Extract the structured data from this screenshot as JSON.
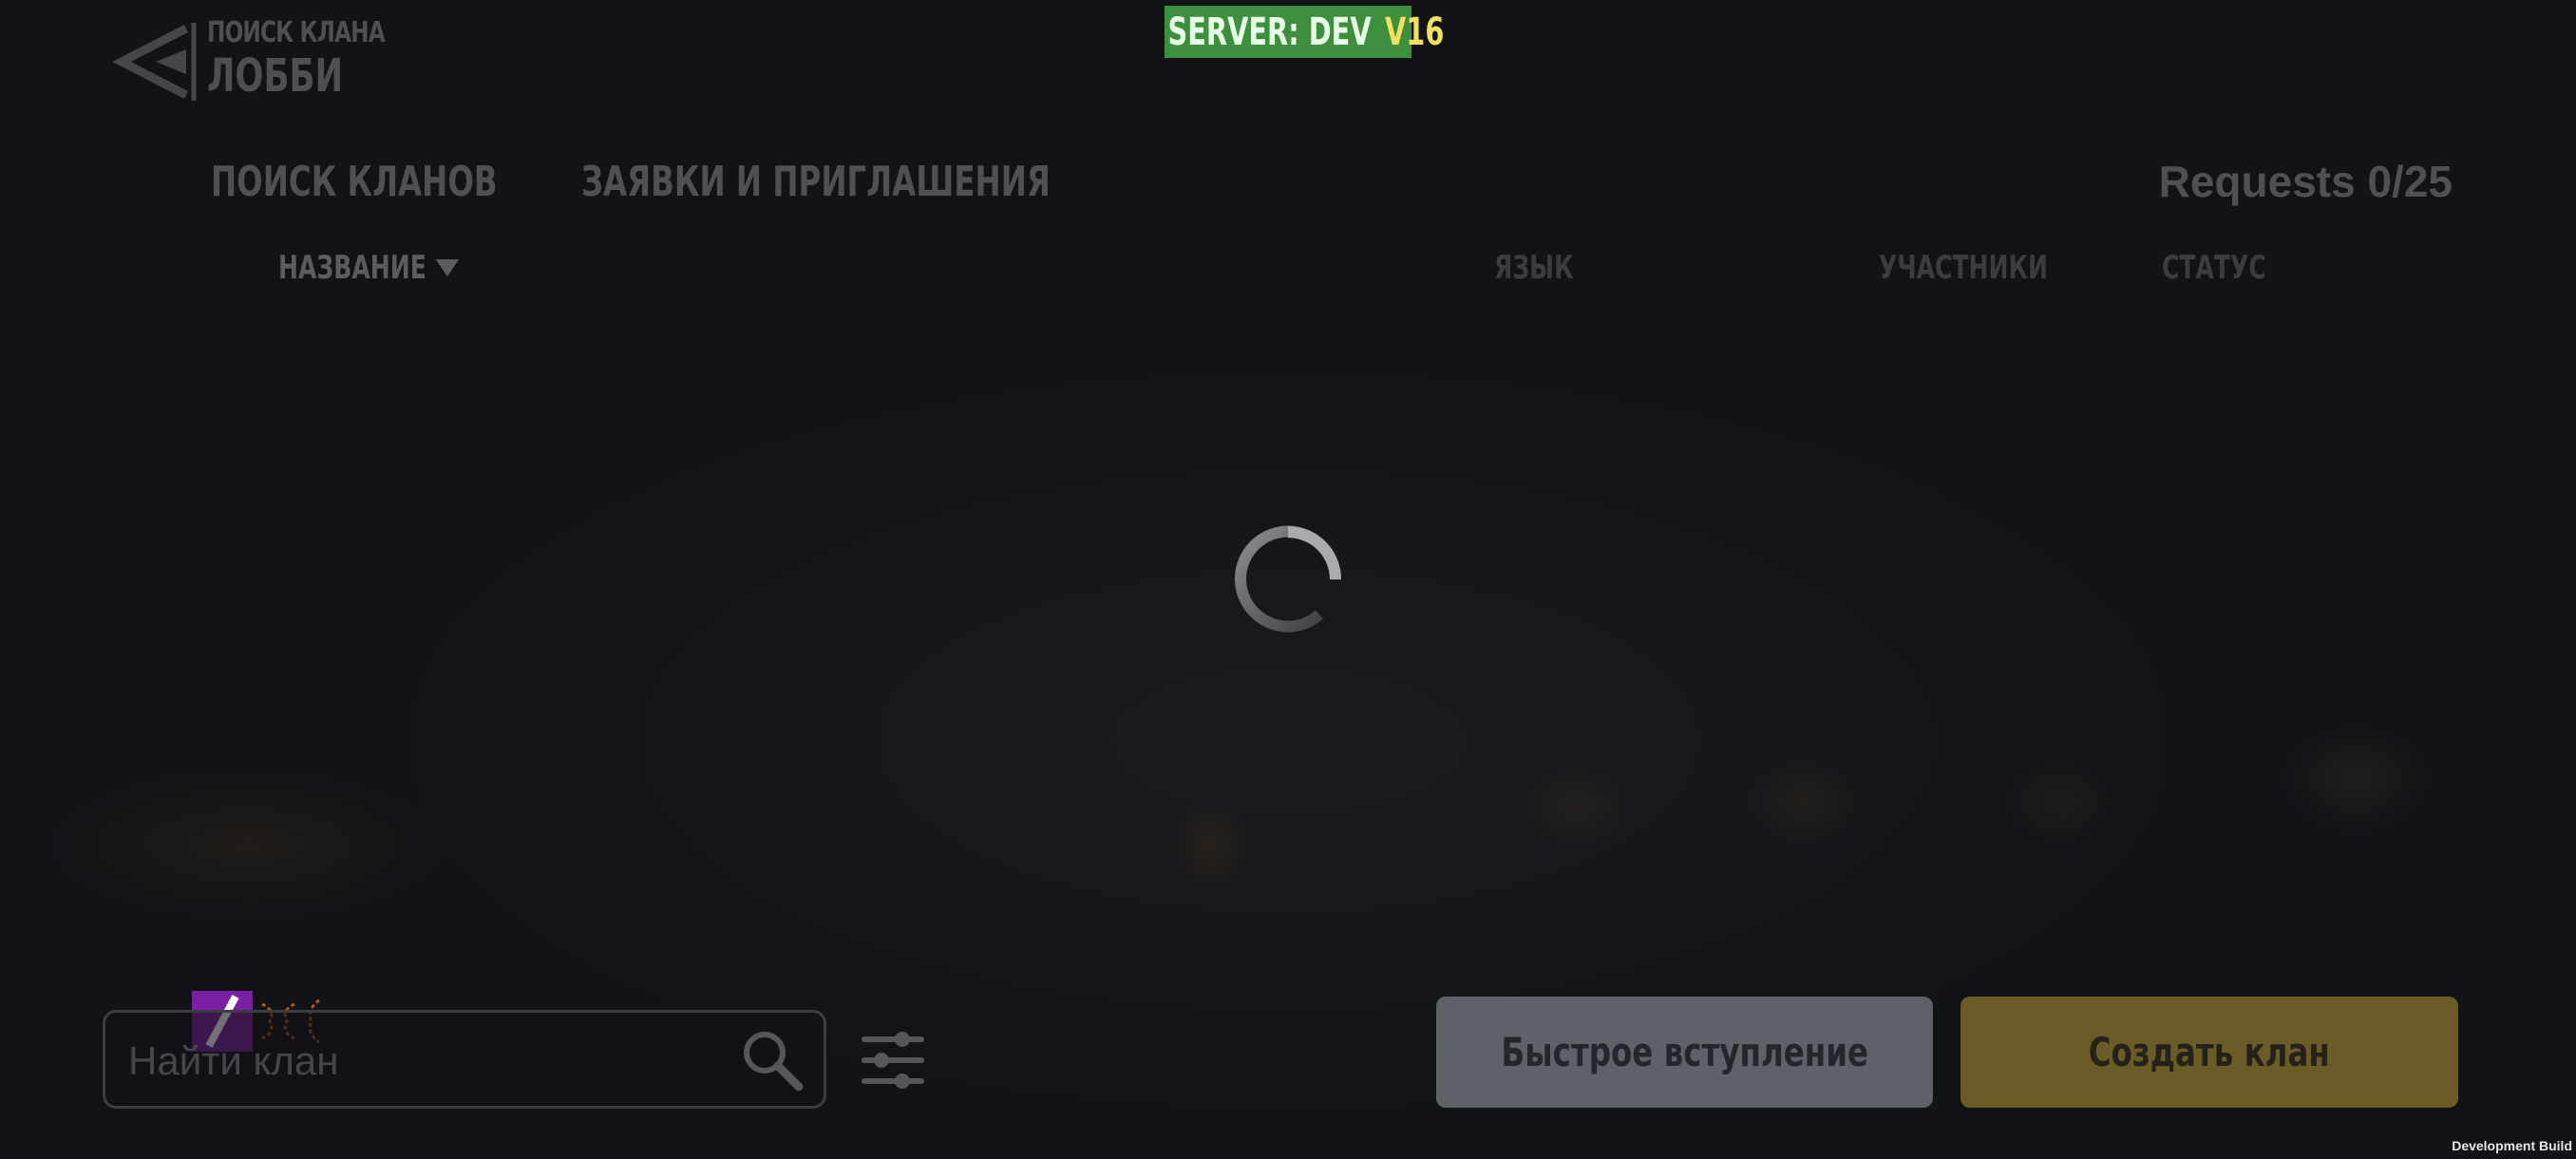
{
  "header": {
    "back_icon": "back-arrow-icon",
    "breadcrumb_small": "ПОИСК КЛАНА",
    "breadcrumb_title": "ЛОББИ"
  },
  "server_badge": {
    "server": "SERVER: DEV",
    "version": "V16",
    "background_color": "#3d8f3d",
    "version_color": "#f0e060"
  },
  "tabs": [
    {
      "label": "ПОИСК КЛАНОВ"
    },
    {
      "label": "ЗАЯВКИ И ПРИГЛАШЕНИЯ"
    }
  ],
  "requests_count": "Requests 0/25",
  "table": {
    "columns": [
      {
        "label": "НАЗВАНИЕ",
        "sorted": "descending",
        "sort_icon": "triangle-down-icon"
      },
      {
        "label": "ЯЗЫК"
      },
      {
        "label": "УЧАСТНИКИ"
      },
      {
        "label": "СТАТУС"
      }
    ],
    "loading": true,
    "loading_icon": "spinner-icon"
  },
  "search": {
    "placeholder": "Найти клан",
    "value": "",
    "search_icon": "magnifier-icon",
    "filter_icon": "sliders-icon"
  },
  "buttons": {
    "quick_join": "Быстрое вступление",
    "create_clan": "Создать клан",
    "quick_join_color": "#5d6269",
    "create_clan_color": "#6b5c27"
  },
  "footer": {
    "build_label": "Development Build"
  }
}
